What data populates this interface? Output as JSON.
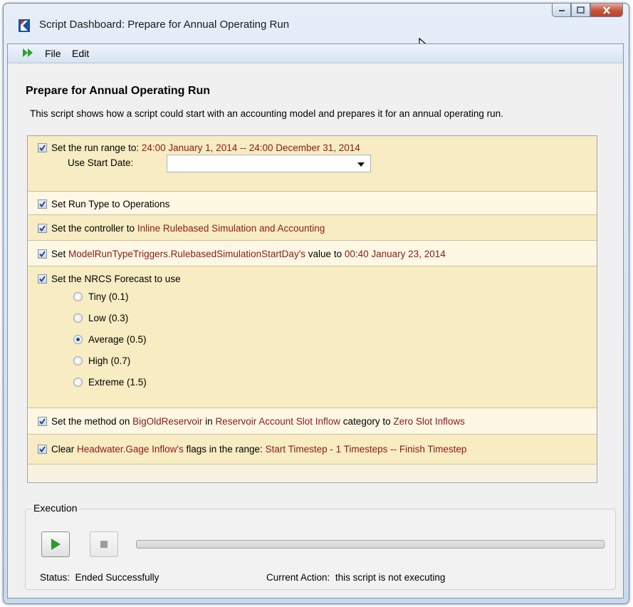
{
  "window": {
    "title": "Script Dashboard: Prepare for Annual Operating Run"
  },
  "menu": {
    "file": "File",
    "edit": "Edit"
  },
  "script": {
    "heading": "Prepare for Annual Operating Run",
    "description": "This script shows how a script could start with an accounting model and prepares it for an annual operating run."
  },
  "actions": {
    "run_range": {
      "prefix": "Set the run range to:",
      "value": "24:00 January 1, 2014 -- 24:00 December 31, 2014",
      "start_date_label": "Use Start Date:",
      "start_date_value": "",
      "checked": true
    },
    "run_type": {
      "text": "Set Run Type to Operations",
      "checked": true
    },
    "controller": {
      "prefix": "Set the controller to",
      "value": "Inline Rulebased Simulation and Accounting",
      "checked": true
    },
    "trigger": {
      "prefix": "Set",
      "slot": "ModelRunTypeTriggers.RulebasedSimulationStartDay's",
      "mid": "value to",
      "value": "00:40 January 23, 2014",
      "checked": true
    },
    "forecast": {
      "label": "Set the NRCS Forecast to use",
      "checked": true,
      "options": [
        "Tiny (0.1)",
        "Low (0.3)",
        "Average (0.5)",
        "High (0.7)",
        "Extreme (1.5)"
      ],
      "selected": "Average (0.5)"
    },
    "method": {
      "p1": "Set the method on",
      "object": "BigOldReservoir",
      "p2": "in",
      "category": "Reservoir Account Slot Inflow",
      "p3": "category to",
      "method": "Zero Slot Inflows",
      "checked": true
    },
    "flags": {
      "p1": "Clear",
      "slot": "Headwater.Gage Inflow's",
      "p2": "flags in the range:",
      "range": "Start Timestep - 1 Timesteps -- Finish Timestep",
      "checked": true
    }
  },
  "execution": {
    "title": "Execution",
    "progress": 0,
    "status_label": "Status:",
    "status_value": "Ended Successfully",
    "current_label": "Current Action:",
    "current_value": "this script is not executing"
  },
  "colors": {
    "accent_red": "#8c1a1a",
    "panel_yellow": "#f8ecc2",
    "play_green": "#2e9a2e"
  }
}
